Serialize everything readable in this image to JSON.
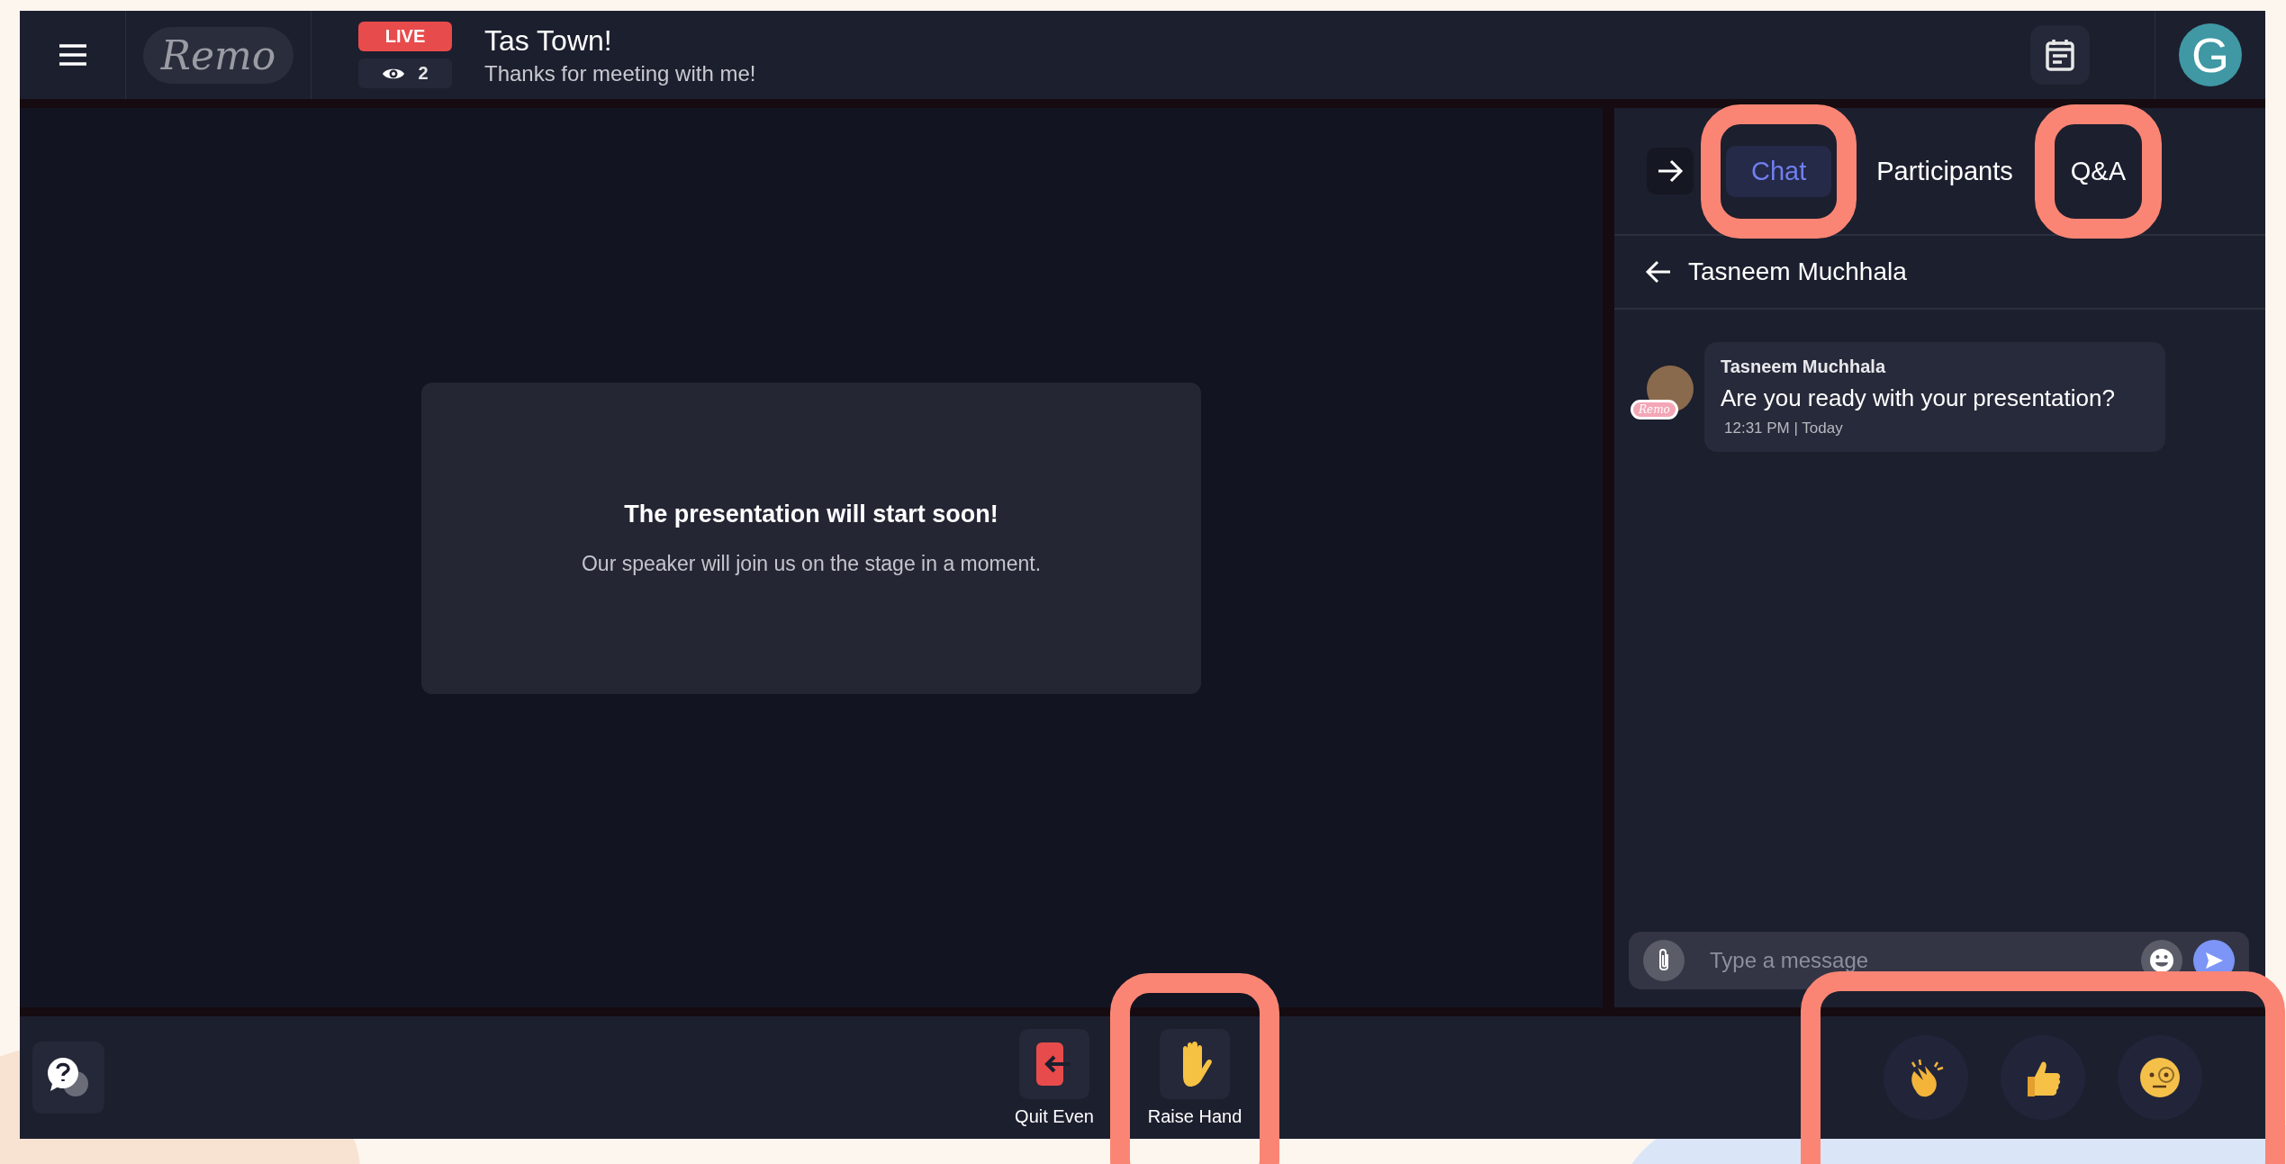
{
  "top_bar": {
    "logo": "Remo",
    "live_badge": "LIVE",
    "viewer_count": "2",
    "event_title": "Tas Town!",
    "event_subtitle": "Thanks for meeting with me!",
    "user_initial": "G"
  },
  "stage": {
    "heading": "The presentation will start soon!",
    "message": "Our speaker will join us on the stage in a moment."
  },
  "side_panel": {
    "tabs": [
      {
        "label": "Chat",
        "selected": true,
        "highlighted": true
      },
      {
        "label": "Participants",
        "selected": false,
        "highlighted": false
      },
      {
        "label": "Q&A",
        "selected": false,
        "highlighted": true
      }
    ],
    "conversation_title": "Tasneem Muchhala",
    "messages": [
      {
        "sender": "Tasneem Muchhala",
        "badge": "Remo",
        "text": "Are you ready with your presentation?",
        "time": "12:31 PM | Today"
      }
    ],
    "composer": {
      "placeholder": "Type a message"
    }
  },
  "bottom_bar": {
    "actions": [
      {
        "kind": "quit",
        "label": "Quit Even",
        "highlighted": false
      },
      {
        "kind": "raise_hand",
        "label": "Raise Hand",
        "highlighted": true
      }
    ],
    "reactions_highlighted": true,
    "reactions": [
      {
        "kind": "clap"
      },
      {
        "kind": "thumbs_up"
      },
      {
        "kind": "monocle"
      }
    ]
  }
}
